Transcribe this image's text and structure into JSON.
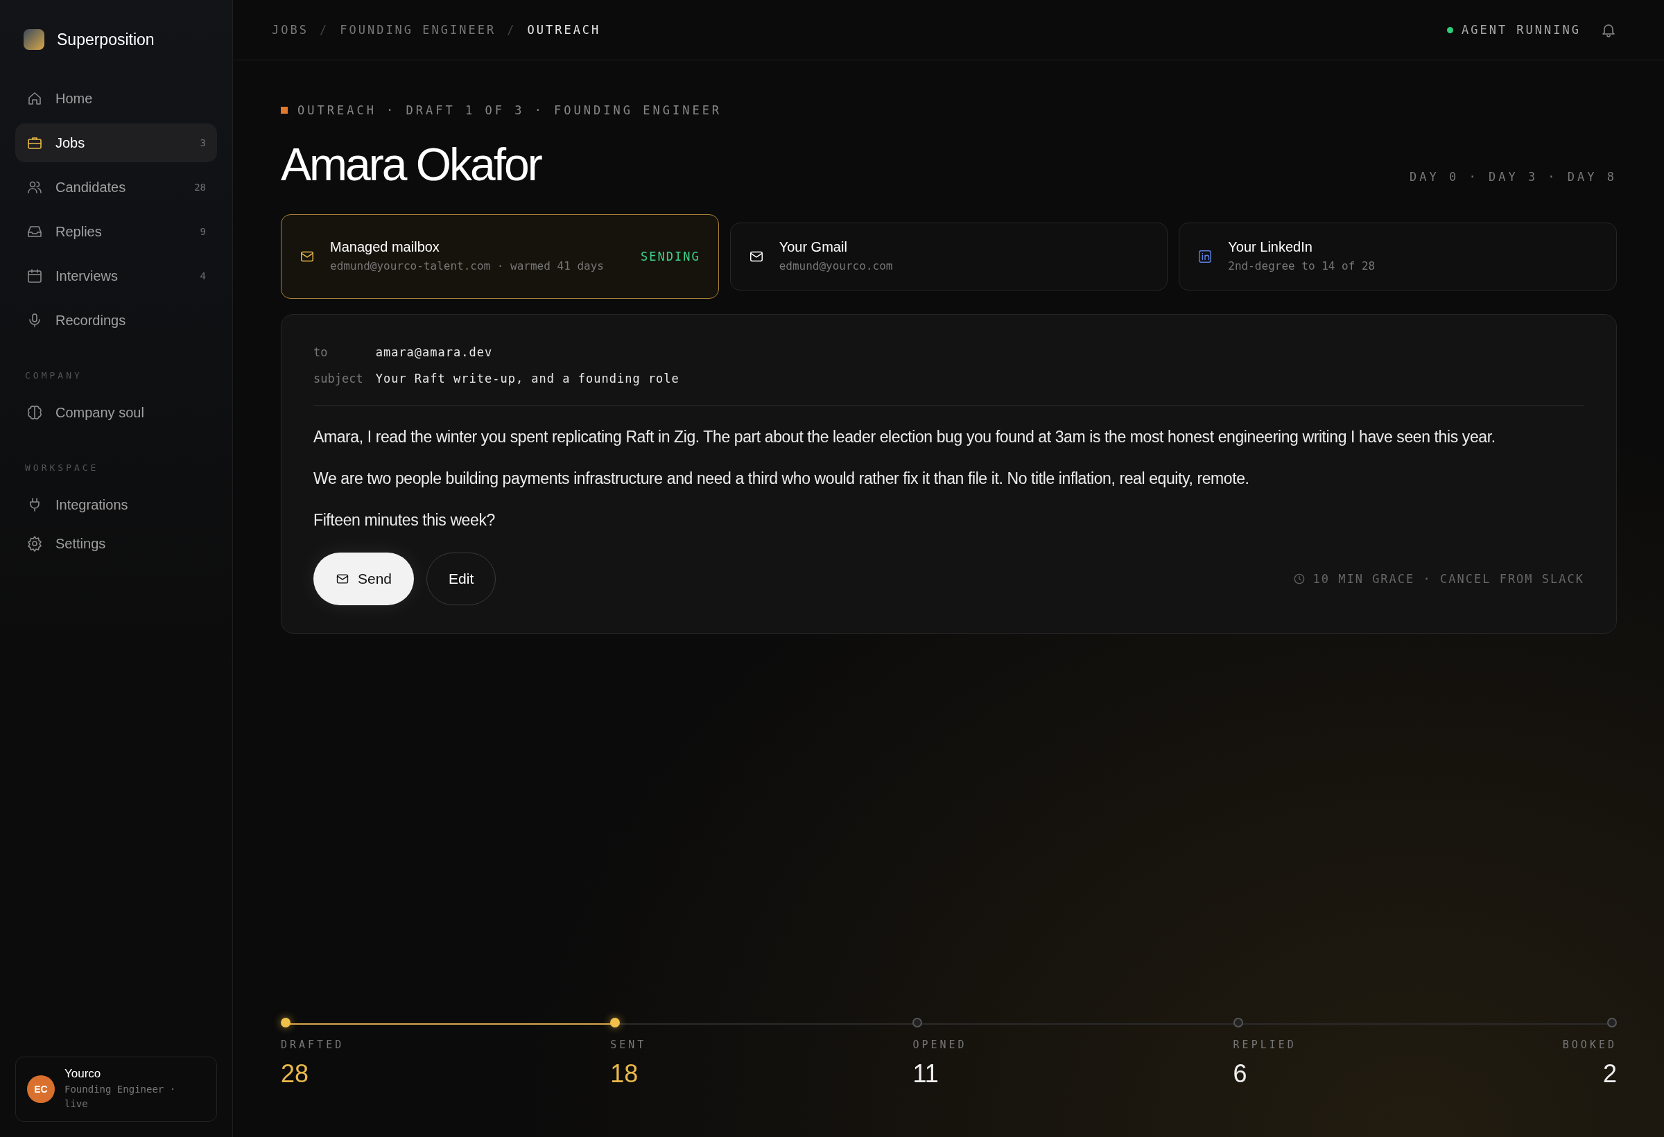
{
  "brand": {
    "name": "Superposition"
  },
  "nav": [
    {
      "label": "Home",
      "selected": false
    },
    {
      "label": "Jobs",
      "count": "3",
      "selected": true
    },
    {
      "label": "Candidates",
      "count": "28",
      "selected": false
    },
    {
      "label": "Replies",
      "count": "9",
      "selected": false
    },
    {
      "label": "Interviews",
      "count": "4",
      "selected": false
    },
    {
      "label": "Recordings",
      "selected": false
    }
  ],
  "sections": [
    {
      "heading": "COMPANY",
      "items": [
        {
          "label": "Company soul",
          "selected": false
        }
      ]
    },
    {
      "heading": "WORKSPACE",
      "items": [
        {
          "label": "Integrations",
          "selected": false
        },
        {
          "label": "Settings",
          "selected": false
        }
      ]
    }
  ],
  "account": {
    "initials": "EC",
    "name": "Yourco",
    "detail": "Founding Engineer · live"
  },
  "breadcrumb": [
    "JOBS",
    "FOUNDING ENGINEER",
    "OUTREACH"
  ],
  "breadcrumb_separator": "/",
  "agent_status": {
    "label": "AGENT RUNNING",
    "on": true
  },
  "eyebrow": "OUTREACH · DRAFT 1 OF 3 · FOUNDING ENGINEER",
  "title": "Amara Okafor",
  "timeline": "DAY 0 · DAY 3 · DAY 8",
  "channels": [
    {
      "kind": "mail",
      "title": "Managed mailbox",
      "detail": "edmund@yourco-talent.com · warmed 41 days",
      "status": "SENDING",
      "selected": true
    },
    {
      "kind": "mail",
      "title": "Your Gmail",
      "detail": "edmund@yourco.com",
      "selected": false
    },
    {
      "kind": "linkedin",
      "title": "Your LinkedIn",
      "detail": "2nd-degree to 14 of 28",
      "selected": false
    }
  ],
  "email": {
    "to_label": "to",
    "to": "amara@amara.dev",
    "subject_label": "subject",
    "subject": "Your Raft write-up, and a founding role",
    "paragraphs": [
      "Amara, I read the winter you spent replicating Raft in Zig. The part about the leader election bug you found at 3am is the most honest engineering writing I have seen this year.",
      "We are two people building payments infrastructure and need a third who would rather fix it than file it. No title inflation, real equity, remote.",
      "Fifteen minutes this week?"
    ],
    "send_label": "Send",
    "edit_label": "Edit",
    "grace_note": "10 MIN GRACE · CANCEL FROM SLACK"
  },
  "funnel": [
    {
      "label": "DRAFTED",
      "value": "28",
      "reached": true
    },
    {
      "label": "SENT",
      "value": "18",
      "reached": true
    },
    {
      "label": "OPENED",
      "value": "11",
      "reached": false
    },
    {
      "label": "REPLIED",
      "value": "6",
      "reached": false
    },
    {
      "label": "BOOKED",
      "value": "2",
      "reached": false
    }
  ]
}
